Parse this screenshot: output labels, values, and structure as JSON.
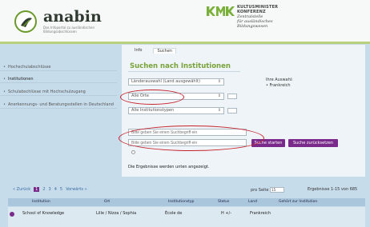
{
  "header": {
    "brand": "anabin",
    "brand_sub": "Das Infoportal zu ausländischen Bildungsabschlüssen",
    "kmk_line1": "KULTUSMINISTER",
    "kmk_line2": "KONFERENZ",
    "kmk_line3": "Zentralstelle",
    "kmk_line4": "für ausländisches",
    "kmk_line5": "Bildungswesen"
  },
  "sidebar": {
    "items": [
      {
        "label": "Hochschulabschlüsse"
      },
      {
        "label": "Institutionen"
      },
      {
        "label": "Schulabschlüsse mit Hochschulzugang"
      },
      {
        "label": "Anerkennungs- und Beratungsstellen in Deutschland"
      }
    ]
  },
  "main": {
    "tabs": [
      {
        "label": "Info"
      },
      {
        "label": "Suchen"
      }
    ],
    "title": "Suchen nach Institutionen",
    "country_select": "Länderauswahl (Land ausgewählt)",
    "place_select": "Alle Orte",
    "type_select": "Alle Institutionstypen",
    "choice_label": "Ihre Auswahl:",
    "choice_item": "Frankreich",
    "search1_placeholder": "Bitte geben Sie einen Suchbegriff ein",
    "search2_placeholder": "Bitte geben Sie einen Suchbegriff ein",
    "search_button": "Suche starten",
    "reset_button": "Suche zurücksetzen",
    "results_note": "Die Ergebnisse werden unten angezeigt."
  },
  "pager": {
    "back": "« Zurück",
    "pages": [
      "1",
      "2",
      "3",
      "4",
      "5"
    ],
    "current": "1",
    "forward": "Vorwärts »",
    "per_page_label": "pro Seite",
    "per_page_value": "15",
    "result_count": "Ergebnisse 1-15 von 685"
  },
  "table": {
    "headers": [
      "Institution",
      "Ort",
      "Institutionstyp",
      "Status",
      "Land",
      "Gehört zur Institution"
    ],
    "rows": [
      {
        "institution": "School of Knowledge",
        "ort": "Lille / Nizza / Sophia",
        "typ": "École de",
        "status": "H +/-",
        "land": "Frankreich",
        "gehoert": ""
      }
    ]
  },
  "colors": {
    "accent_purple": "#7a2a8a",
    "accent_green": "#7aa23a",
    "annotation_red": "#c8202a"
  }
}
